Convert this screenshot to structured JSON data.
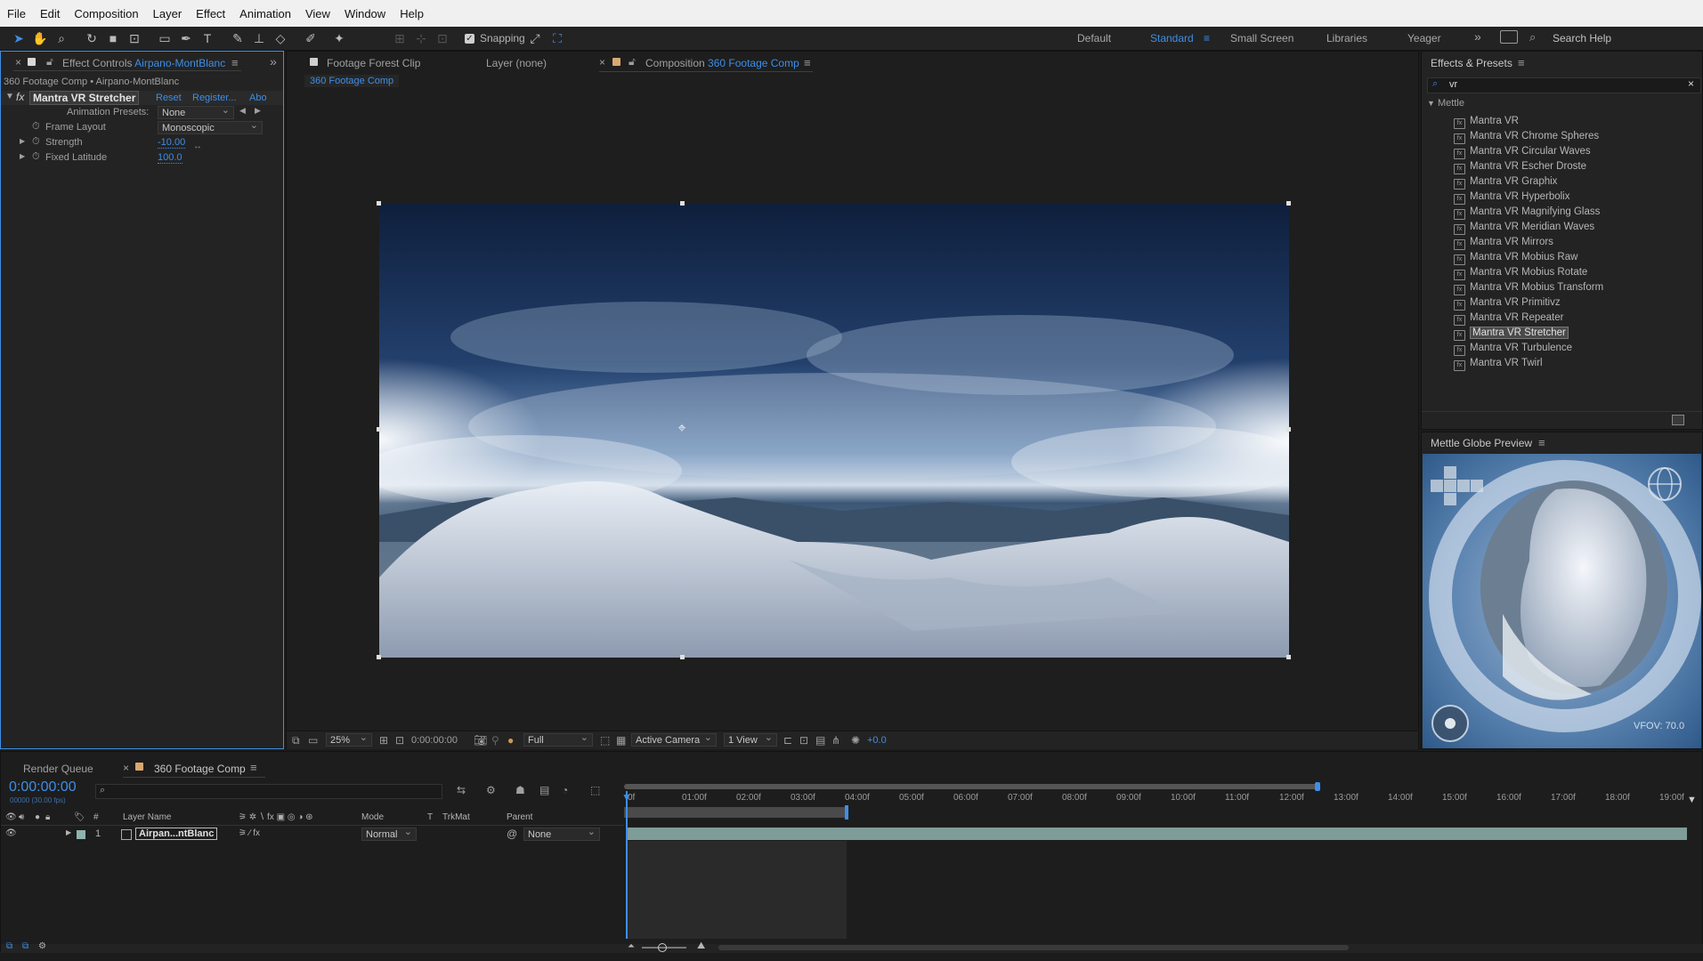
{
  "menu": [
    "File",
    "Edit",
    "Composition",
    "Layer",
    "Effect",
    "Animation",
    "View",
    "Window",
    "Help"
  ],
  "toolbar": {
    "snapping_label": "Snapping",
    "workspaces": [
      "Default",
      "Standard",
      "Small Screen",
      "Libraries",
      "Yeager"
    ],
    "active_workspace": "Standard",
    "search_help": "Search Help"
  },
  "effect_controls": {
    "tab_prefix": "Effect Controls",
    "tab_layer": "Airpano-MontBlanc",
    "breadcrumb": "360 Footage Comp • Airpano-MontBlanc",
    "effect_name": "Mantra VR Stretcher",
    "reset": "Reset",
    "register": "Register...",
    "about": "Abo",
    "fx": "fx",
    "props": [
      {
        "label": "Animation Presets:",
        "value": "None"
      },
      {
        "label": "Frame Layout",
        "value": "Monoscopic"
      },
      {
        "label": "Strength",
        "value": "-10.00"
      },
      {
        "label": "Fixed Latitude",
        "value": "100.0"
      }
    ]
  },
  "viewer": {
    "tabs": [
      "Footage Forest Clip",
      "Layer (none)"
    ],
    "comp_tab_prefix": "Composition",
    "comp_tab_name": "360 Footage Comp",
    "sub_tab": "360 Footage Comp",
    "zoom": "25%",
    "timecode": "0:00:00:00",
    "resolution": "Full",
    "camera": "Active Camera",
    "views": "1 View",
    "exposure": "+0.0"
  },
  "effects_presets": {
    "title": "Effects & Presets",
    "search_value": "vr",
    "group": "Mettle",
    "items": [
      "Mantra VR",
      "Mantra VR Chrome Spheres",
      "Mantra VR Circular Waves",
      "Mantra VR Escher Droste",
      "Mantra VR Graphix",
      "Mantra VR Hyperbolix",
      "Mantra VR Magnifying Glass",
      "Mantra VR Meridian Waves",
      "Mantra VR Mirrors",
      "Mantra VR Mobius Raw",
      "Mantra VR Mobius Rotate",
      "Mantra VR Mobius Transform",
      "Mantra VR Primitivz",
      "Mantra VR Repeater",
      "Mantra VR Stretcher",
      "Mantra VR Turbulence",
      "Mantra VR Twirl"
    ],
    "selected": "Mantra VR Stretcher"
  },
  "globe_preview": {
    "title": "Mettle Globe Preview",
    "vfov": "VFOV: 70.0"
  },
  "timeline": {
    "tabs": [
      "Render Queue",
      "360 Footage Comp"
    ],
    "timecode": "0:00:00:00",
    "frame_info": "00000 (30.00 fps)",
    "headers": {
      "hash": "#",
      "layer_name": "Layer Name",
      "mode": "Mode",
      "t": "T",
      "trkmat": "TrkMat",
      "parent": "Parent"
    },
    "layer": {
      "index": "1",
      "name": "Airpan...ntBlanc",
      "mode": "Normal",
      "parent": "None"
    },
    "ruler": [
      "0f",
      "01:00f",
      "02:00f",
      "03:00f",
      "04:00f",
      "05:00f",
      "06:00f",
      "07:00f",
      "08:00f",
      "09:00f",
      "10:00f",
      "11:00f",
      "12:00f",
      "13:00f",
      "14:00f",
      "15:00f",
      "16:00f",
      "17:00f",
      "18:00f",
      "19:00f"
    ]
  },
  "colors": {
    "accent": "#3e8ee6",
    "panel": "#232323",
    "bg": "#1c1c1c",
    "layer_bar": "#8fb3ae"
  }
}
